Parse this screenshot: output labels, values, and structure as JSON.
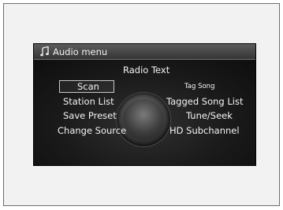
{
  "title": "Audio menu",
  "icons": {
    "title": "music-note-icon"
  },
  "menu": {
    "radio_text": "Radio Text",
    "scan": "Scan",
    "tag_song": "Tag Song",
    "station_list": "Station List",
    "tagged_song_list": "Tagged Song List",
    "save_preset": "Save Preset",
    "tune_seek": "Tune/Seek",
    "change_source": "Change Source",
    "hd_subchannel": "HD Subchannel",
    "selected": "Scan"
  }
}
